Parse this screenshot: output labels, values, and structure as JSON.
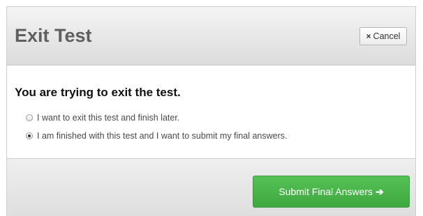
{
  "dialog": {
    "title": "Exit Test",
    "cancel": {
      "icon": "close-icon",
      "glyph": "×",
      "label": "Cancel"
    }
  },
  "body": {
    "heading": "You are trying to exit the test.",
    "options": [
      {
        "label": "I want to exit this test and finish later.",
        "selected": false
      },
      {
        "label": "I am finished with this test and I want to submit my final answers.",
        "selected": true
      }
    ]
  },
  "footer": {
    "submit": {
      "label": "Submit Final Answers",
      "icon": "arrow-right-icon",
      "glyph": "➔",
      "color": "#4cb84c"
    }
  }
}
